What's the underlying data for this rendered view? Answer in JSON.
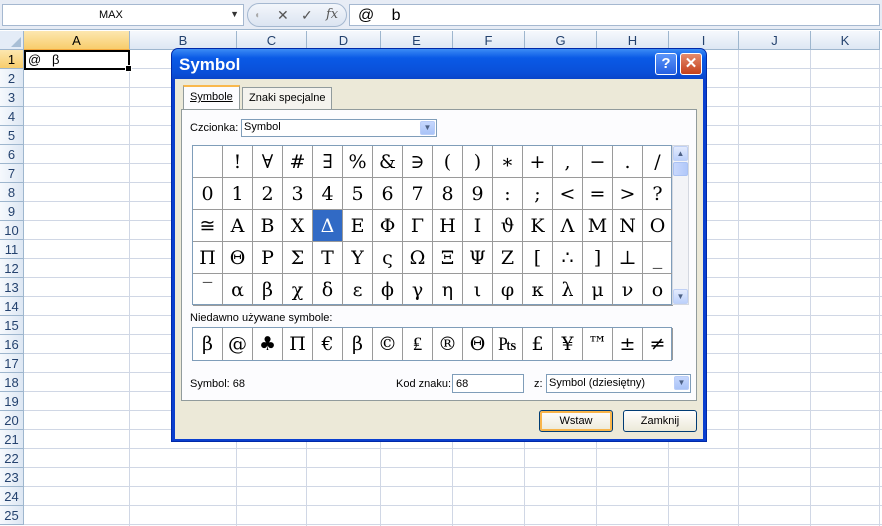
{
  "formula_bar": {
    "name_box": "MAX",
    "formula_text": "@   b",
    "buttons": [
      "✕",
      "✓",
      "fx"
    ]
  },
  "sheet": {
    "columns": [
      "A",
      "B",
      "C",
      "D",
      "E",
      "F",
      "G",
      "H",
      "I",
      "J",
      "K"
    ],
    "rows": [
      "1",
      "2",
      "3",
      "4",
      "5",
      "6",
      "7",
      "8",
      "9",
      "10",
      "11",
      "12",
      "13",
      "14",
      "15",
      "16",
      "17",
      "18",
      "19",
      "20",
      "21",
      "22",
      "23",
      "24",
      "25"
    ],
    "selected_column": "A",
    "selected_row": "1",
    "cell_a1": "@   β"
  },
  "dialog": {
    "title": "Symbol",
    "help_glyph": "?",
    "close_glyph": "✕",
    "tabs": [
      "Symbole",
      "Znaki specjalne"
    ],
    "font_label": "Czcionka:",
    "font_value": "Symbol",
    "symbols": [
      " ",
      "!",
      "∀",
      "#",
      "∃",
      "%",
      "&",
      "∋",
      "(",
      ")",
      "∗",
      "+",
      ",",
      "−",
      ".",
      "/",
      "0",
      "1",
      "2",
      "3",
      "4",
      "5",
      "6",
      "7",
      "8",
      "9",
      ":",
      ";",
      "<",
      "=",
      ">",
      "?",
      "≅",
      "Α",
      "Β",
      "Χ",
      "Δ",
      "Ε",
      "Φ",
      "Γ",
      "Η",
      "Ι",
      "ϑ",
      "Κ",
      "Λ",
      "Μ",
      "Ν",
      "Ο",
      "Π",
      "Θ",
      "Ρ",
      "Σ",
      "Τ",
      "Υ",
      "ς",
      "Ω",
      "Ξ",
      "Ψ",
      "Ζ",
      "[",
      "∴",
      "]",
      "⊥",
      "_",
      "‾",
      "α",
      "β",
      "χ",
      "δ",
      "ε",
      "ϕ",
      "γ",
      "η",
      "ι",
      "φ",
      "κ",
      "λ",
      "μ",
      "ν",
      "ο"
    ],
    "selected_symbol_index": 36,
    "recent_label": "Niedawno używane symbole:",
    "recent_symbols": [
      "β",
      "@",
      "♣",
      "Π",
      "€",
      "β",
      "©",
      "₤",
      "®",
      "Θ",
      "₧",
      "£",
      "¥",
      "™",
      "±",
      "≠"
    ],
    "symbol_info": "Symbol: 68",
    "code_label": "Kod znaku:",
    "code_value": "68",
    "from_label": "z:",
    "from_value": "Symbol (dziesiętny)",
    "insert_label": "Wstaw",
    "close_label": "Zamknij"
  }
}
